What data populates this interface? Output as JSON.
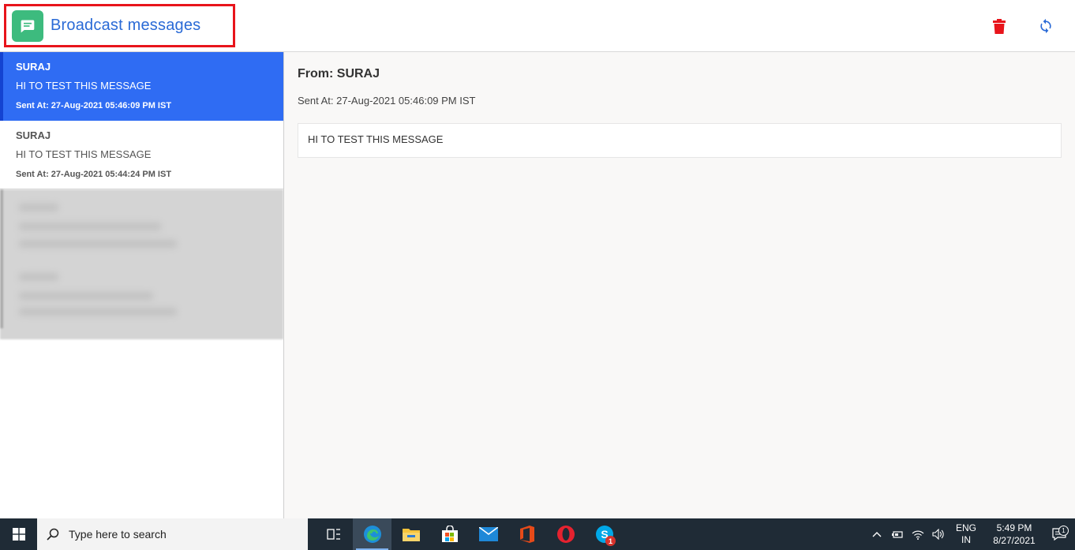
{
  "header": {
    "title": "Broadcast messages",
    "icons": {
      "app": "chat-message-icon",
      "delete": "trash-icon",
      "refresh": "refresh-icon"
    },
    "colors": {
      "title": "#2a6ad6",
      "app_icon_bg": "#3dbb7e",
      "delete": "#e8141b",
      "refresh": "#2a6ad6",
      "highlight_border": "#e8141b"
    }
  },
  "messages": [
    {
      "sender": "SURAJ",
      "text": "HI TO TEST THIS MESSAGE",
      "sent_at": "Sent At: 27-Aug-2021 05:46:09 PM IST",
      "selected": true
    },
    {
      "sender": "SURAJ",
      "text": "HI TO TEST THIS MESSAGE",
      "sent_at": "Sent At: 27-Aug-2021 05:44:24 PM IST",
      "selected": false
    }
  ],
  "detail": {
    "from": "From: SURAJ",
    "sent_at": "Sent At: 27-Aug-2021 05:46:09 PM IST",
    "body": "HI TO TEST THIS MESSAGE"
  },
  "taskbar": {
    "search_placeholder": "Type here to search",
    "apps": [
      "task-view-icon",
      "edge-icon",
      "file-explorer-icon",
      "store-icon",
      "mail-icon",
      "office-icon",
      "opera-icon",
      "skype-icon"
    ],
    "skype_badge": "1",
    "tray": {
      "lang_line1": "ENG",
      "lang_line2": "IN",
      "time": "5:49 PM",
      "date": "8/27/2021",
      "notification_count": "1"
    }
  },
  "colors": {
    "selected_item_bg": "#2f6cf3",
    "taskbar_bg": "#1f2b36",
    "detail_bg": "#f9f8f7"
  }
}
